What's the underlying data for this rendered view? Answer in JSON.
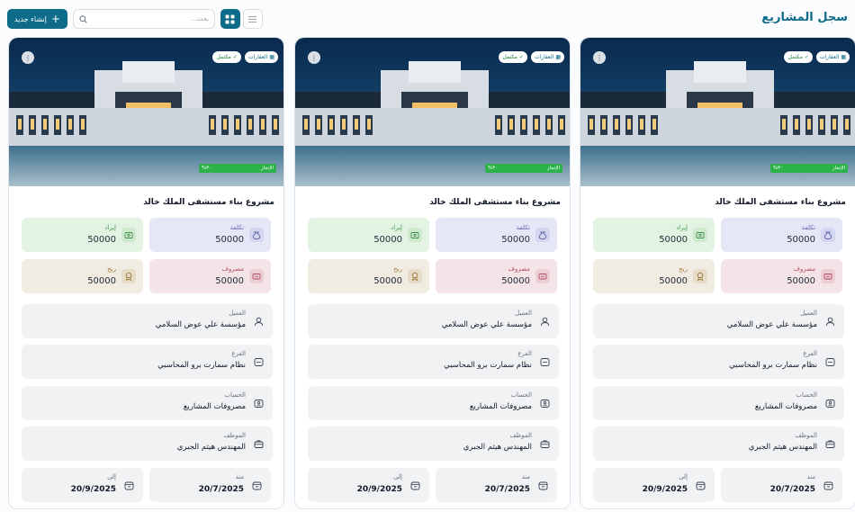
{
  "header": {
    "title": "سجل المشاريع",
    "new_button": "إنشاء جديد",
    "search_placeholder": "بحث..."
  },
  "colors": {
    "primary": "#0e6b8a",
    "progress": "#2bb34a"
  },
  "cards": [
    {
      "title": "مشروع بناء مستشفى الملك خالد",
      "badges": {
        "type": "العقارات",
        "status": "مكتمل"
      },
      "progress": {
        "label": "الإنجاز",
        "value": "٣٠%",
        "fraction": 0.3
      },
      "stats": {
        "cost": {
          "label": "تكلفة",
          "value": "50000"
        },
        "revenue": {
          "label": "إيراد",
          "value": "50000"
        },
        "expense": {
          "label": "مصروف",
          "value": "50000"
        },
        "profit": {
          "label": "ربح",
          "value": "50000"
        }
      },
      "client": {
        "label": "العميل",
        "value": "مؤسسة علي عوض السلامي"
      },
      "branch": {
        "label": "الفرع",
        "value": "نظام سمارت برو المحاسبي"
      },
      "account": {
        "label": "الحساب",
        "value": "مصروفات المشاريع"
      },
      "employee": {
        "label": "الموظف",
        "value": "المهندس هيثم الجبري"
      },
      "from": {
        "label": "منذ",
        "value": "20/7/2025"
      },
      "to": {
        "label": "إلى",
        "value": "20/9/2025"
      }
    },
    {
      "title": "مشروع بناء مستشفى الملك خالد",
      "badges": {
        "type": "العقارات",
        "status": "مكتمل"
      },
      "progress": {
        "label": "الإنجاز",
        "value": "٣٠%",
        "fraction": 0.3
      },
      "stats": {
        "cost": {
          "label": "تكلفة",
          "value": "50000"
        },
        "revenue": {
          "label": "إيراد",
          "value": "50000"
        },
        "expense": {
          "label": "مصروف",
          "value": "50000"
        },
        "profit": {
          "label": "ربح",
          "value": "50000"
        }
      },
      "client": {
        "label": "العميل",
        "value": "مؤسسة علي عوض السلامي"
      },
      "branch": {
        "label": "الفرع",
        "value": "نظام سمارت برو المحاسبي"
      },
      "account": {
        "label": "الحساب",
        "value": "مصروفات المشاريع"
      },
      "employee": {
        "label": "الموظف",
        "value": "المهندس هيثم الجبري"
      },
      "from": {
        "label": "منذ",
        "value": "20/7/2025"
      },
      "to": {
        "label": "إلى",
        "value": "20/9/2025"
      }
    },
    {
      "title": "مشروع بناء مستشفى الملك خالد",
      "badges": {
        "type": "العقارات",
        "status": "مكتمل"
      },
      "progress": {
        "label": "الإنجاز",
        "value": "٣٠%",
        "fraction": 0.3
      },
      "stats": {
        "cost": {
          "label": "تكلفة",
          "value": "50000"
        },
        "revenue": {
          "label": "إيراد",
          "value": "50000"
        },
        "expense": {
          "label": "مصروف",
          "value": "50000"
        },
        "profit": {
          "label": "ربح",
          "value": "50000"
        }
      },
      "client": {
        "label": "العميل",
        "value": "مؤسسة علي عوض السلامي"
      },
      "branch": {
        "label": "الفرع",
        "value": "نظام سمارت برو المحاسبي"
      },
      "account": {
        "label": "الحساب",
        "value": "مصروفات المشاريع"
      },
      "employee": {
        "label": "الموظف",
        "value": "المهندس هيثم الجبري"
      },
      "from": {
        "label": "منذ",
        "value": "20/7/2025"
      },
      "to": {
        "label": "إلى",
        "value": "20/9/2025"
      }
    }
  ]
}
